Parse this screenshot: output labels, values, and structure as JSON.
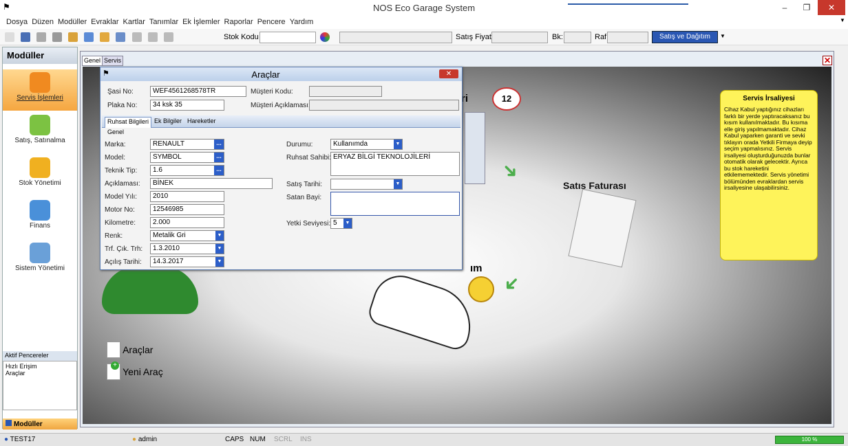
{
  "window": {
    "title": "NOS Eco Garage System",
    "minimize": "–",
    "maximize": "❐",
    "close": "✕"
  },
  "menu": [
    "Dosya",
    "Düzen",
    "Modüller",
    "Evraklar",
    "Kartlar",
    "Tanımlar",
    "Ek İşlemler",
    "Raporlar",
    "Pencere",
    "Yardım"
  ],
  "toolbar": {
    "stok_kodu_label": "Stok Kodu",
    "satis_fiyati_label": "Satış Fiyatı",
    "bk_label": "Bk:",
    "raf_label": "Raf",
    "satis_dagitim_button": "Satış ve Dağıtım"
  },
  "sidebar": {
    "title": "Modüller",
    "modules": [
      {
        "label": "Servis İşlemleri",
        "icon": "tools-icon"
      },
      {
        "label": "Satış, Satınalma",
        "icon": "check-pen-icon"
      },
      {
        "label": "Stok Yönetimi",
        "icon": "gear-icon"
      },
      {
        "label": "Finans",
        "icon": "folder-icon"
      },
      {
        "label": "Sistem Yönetimi",
        "icon": "system-icon"
      }
    ],
    "active_windows_title": "Aktif Pencereler",
    "active_windows": [
      "Hızlı Erişim",
      "Araçlar"
    ],
    "bottom_tab": "Modüller"
  },
  "main": {
    "tabs": [
      "Genel",
      "Servis"
    ],
    "bubble_number": "12",
    "satis_faturasi": "Satış Faturası",
    "partial_text_r": "ri",
    "partial_text_m": "ım",
    "shortcuts": [
      {
        "label": "Araçlar"
      },
      {
        "label": "Yeni Araç"
      }
    ],
    "note": {
      "title": "Servis İrsaliyesi",
      "body": "Cihaz Kabul yaptığınız cihazları farklı bir yerde yaptıracaksanız bu kısım kullanılmaktadır. Bu kısıma elle giriş yapılmamaktadır. Cihaz Kabul yaparken garanti ve sevki tıklayın orada Yetkili Firmaya deyip seçim yapmalısınız. Servis irsaliyesi oluşturduğunuzda bunlar otomatik olarak gelecektir. Ayrıca bu stok hareketini etkilememektedir. Servis yönetimi bölümünden evraklardan servis irsaliyesine ulaşabilirsiniz."
    }
  },
  "dialog": {
    "title": "Araçlar",
    "sasi_no_label": "Şasi No:",
    "sasi_no": "WEF4561268578TR",
    "plaka_no_label": "Plaka No:",
    "plaka_no": "34 ksk 35",
    "musteri_kodu_label": "Müşteri Kodu:",
    "musteri_aciklamasi_label": "Müşteri Açıklaması:",
    "tabs": [
      "Ruhsat Bilgileri",
      "Ek Bilgiler",
      "Hareketler"
    ],
    "group": "Genel",
    "left_fields": [
      {
        "label": "Marka:",
        "value": "RENAULT",
        "kind": "dots"
      },
      {
        "label": "Model:",
        "value": "SYMBOL",
        "kind": "dots"
      },
      {
        "label": "Teknik Tip:",
        "value": "1.6",
        "kind": "dots"
      },
      {
        "label": "Açıklaması:",
        "value": "BİNEK",
        "kind": "text"
      },
      {
        "label": "Model Yılı:",
        "value": "2010",
        "kind": "text"
      },
      {
        "label": "Motor No:",
        "value": "12546985",
        "kind": "text"
      },
      {
        "label": "Kilometre:",
        "value": "2.000",
        "kind": "text"
      },
      {
        "label": "Renk:",
        "value": "Metalik Gri",
        "kind": "dd"
      },
      {
        "label": "Trf. Çık. Trh:",
        "value": "1.3.2010",
        "kind": "dd"
      },
      {
        "label": "Açılış Tarihi:",
        "value": "14.3.2017",
        "kind": "dd"
      }
    ],
    "durumu_label": "Durumu:",
    "durumu": "Kullanımda",
    "ruhsat_sahibi_label": "Ruhsat Sahibi:",
    "ruhsat_sahibi": "ERYAZ BİLGİ TEKNOLOJİLERİ",
    "satis_tarihi_label": "Satış Tarihi:",
    "satan_bayi_label": "Satan Bayi:",
    "yetki_label": "Yetki Seviyesi:",
    "yetki": "5"
  },
  "status": {
    "test": "TEST17",
    "user": "admin",
    "caps": "CAPS",
    "num": "NUM",
    "scrl": "SCRL",
    "ins": "INS",
    "progress": "100 %"
  }
}
